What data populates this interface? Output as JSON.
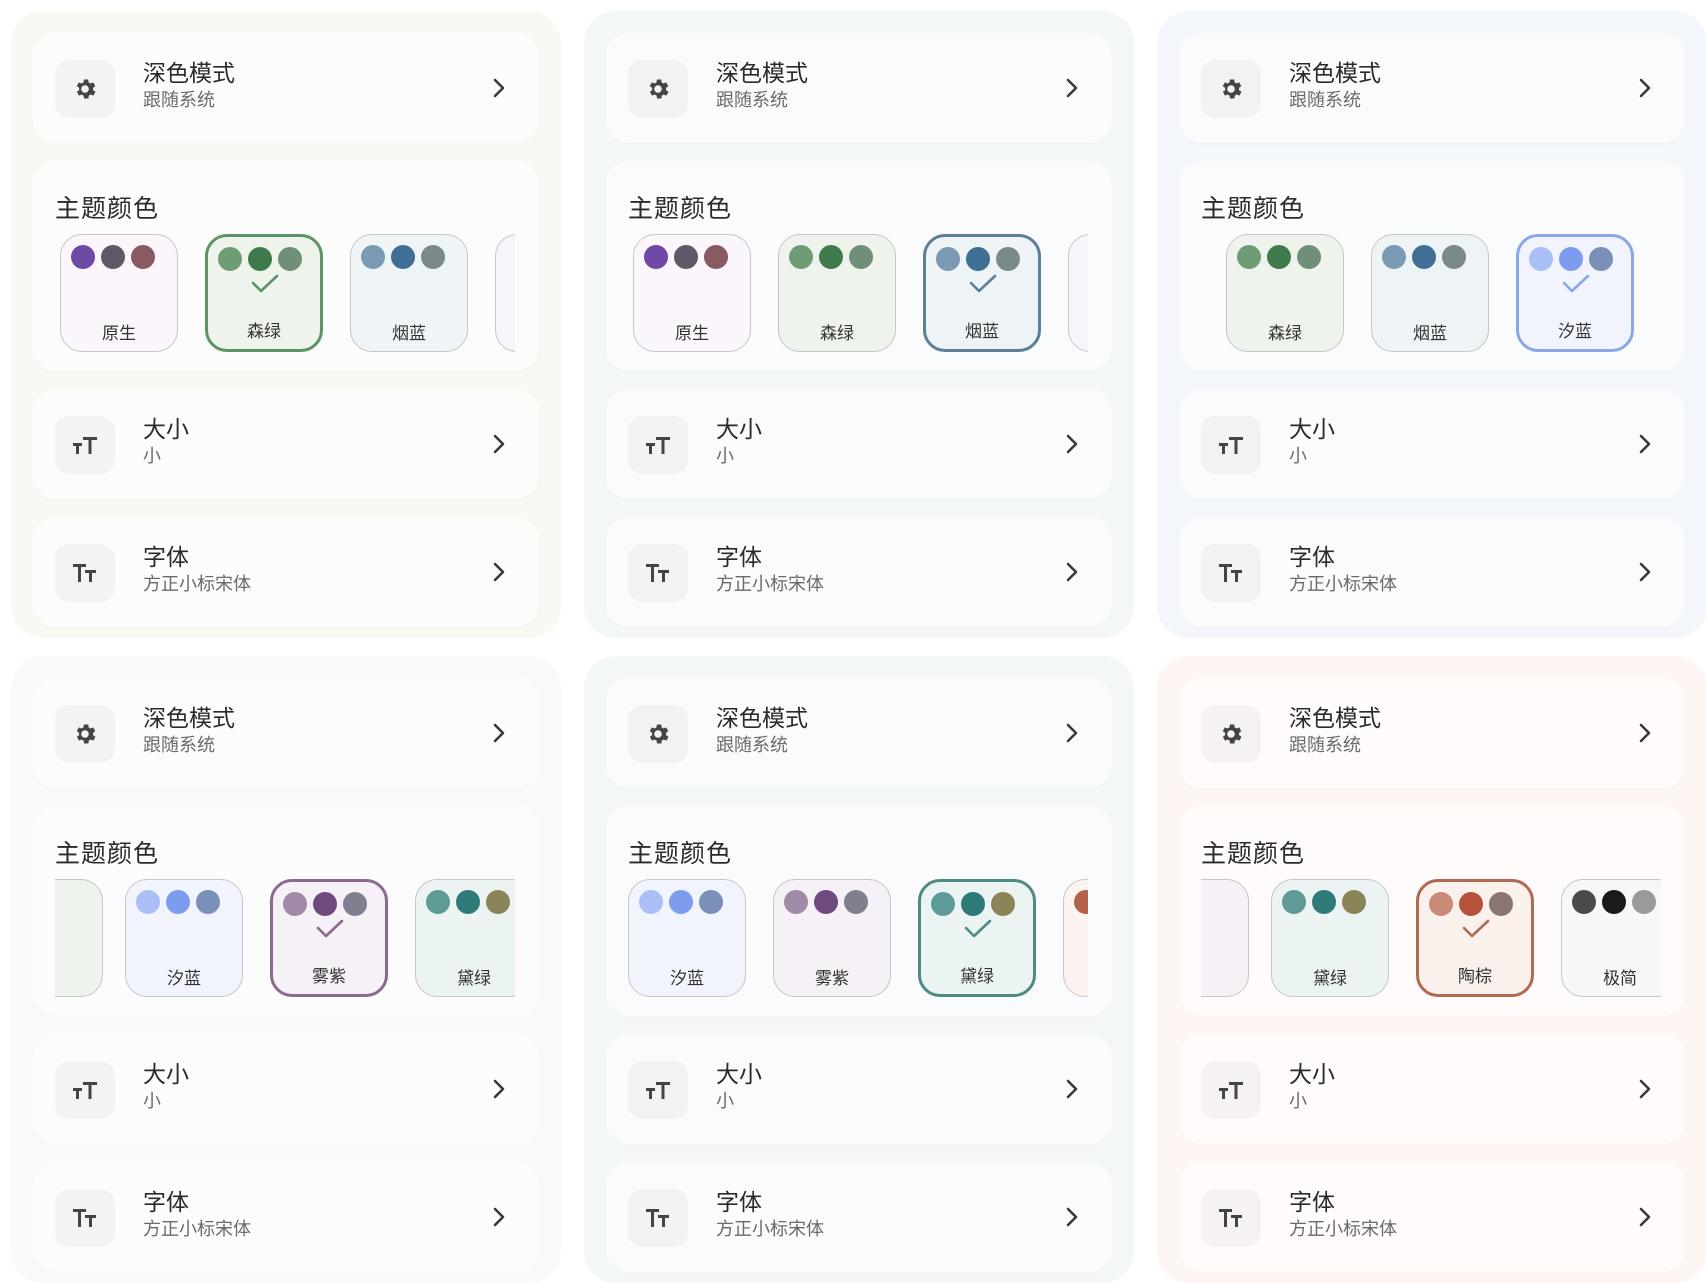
{
  "labels": {
    "dark_mode_title": "深色模式",
    "dark_mode_value": "跟随系统",
    "theme_color_title": "主题颜色",
    "size_title": "大小",
    "size_value": "小",
    "font_title": "字体",
    "font_value": "方正小标宋体"
  },
  "icons": {
    "dark_mode": "gear-icon",
    "size": "text-size-icon",
    "font": "font-icon",
    "chevron": "chevron-right-icon",
    "selected_mark": "check-icon"
  },
  "panels": [
    {
      "bg": "#f9f9f3",
      "swatches": [
        {
          "label": "原生",
          "dots": [
            "#6e4aa6",
            "#5e5868",
            "#8a5a62"
          ],
          "bg": "#fbf6fb",
          "border": "#c6c4c8",
          "selected": false
        },
        {
          "label": "森绿",
          "dots": [
            "#6f9b75",
            "#3f7a4c",
            "#6f8f78"
          ],
          "bg": "#eef4ec",
          "border": "#5b9467",
          "selected": true
        },
        {
          "label": "烟蓝",
          "dots": [
            "#7b9ab4",
            "#3f6f94",
            "#7a8a8a"
          ],
          "bg": "#eff4f7",
          "border": "#c4c7c9",
          "selected": false
        },
        {
          "label": "",
          "dots": [],
          "bg": "#f5f6fa",
          "border": "#c6c8cc",
          "selected": false
        }
      ]
    },
    {
      "bg": "#f3f7f8",
      "swatches": [
        {
          "label": "原生",
          "dots": [
            "#6e4aa6",
            "#5e5868",
            "#8a5a62"
          ],
          "bg": "#fbf6fb",
          "border": "#c6c4c8",
          "selected": false
        },
        {
          "label": "森绿",
          "dots": [
            "#6f9b75",
            "#3f7a4c",
            "#6f8f78"
          ],
          "bg": "#eef4ec",
          "border": "#c4c8c4",
          "selected": false
        },
        {
          "label": "烟蓝",
          "dots": [
            "#7b9ab4",
            "#3f6f94",
            "#7a8a8a"
          ],
          "bg": "#eef3f6",
          "border": "#5d7f98",
          "selected": true
        },
        {
          "label": "",
          "dots": [],
          "bg": "#f5f6fa",
          "border": "#c6c8cc",
          "selected": false
        }
      ]
    },
    {
      "bg": "#f3f6fb",
      "swatches": [
        {
          "label": "",
          "dots": [],
          "bg": "#f2f4f6",
          "border": "#c6c8cc",
          "selected": false
        },
        {
          "label": "森绿",
          "dots": [
            "#6f9b75",
            "#3f7a4c",
            "#6f8f78"
          ],
          "bg": "#eef4ec",
          "border": "#c4c8c4",
          "selected": false
        },
        {
          "label": "烟蓝",
          "dots": [
            "#7b9ab4",
            "#3f6f94",
            "#7a8a8a"
          ],
          "bg": "#eef3f6",
          "border": "#c4c7c9",
          "selected": false
        },
        {
          "label": "汐蓝",
          "dots": [
            "#a9bff5",
            "#7d9cf0",
            "#7a90b8"
          ],
          "bg": "#f1f4fc",
          "border": "#8aa7e8",
          "selected": true
        }
      ]
    },
    {
      "bg": "#fbf8fb",
      "swatches": [
        {
          "label": "",
          "dots": [
            "#6f8f78"
          ],
          "bg": "#eef4ec",
          "border": "#c4c8c4",
          "selected": false
        },
        {
          "label": "汐蓝",
          "dots": [
            "#a9bff5",
            "#7d9cf0",
            "#7a90b8"
          ],
          "bg": "#f1f4fc",
          "border": "#c4c7cc",
          "selected": false
        },
        {
          "label": "雾紫",
          "dots": [
            "#a08aa8",
            "#6e4a7e",
            "#7f7f8f"
          ],
          "bg": "#f6f1f7",
          "border": "#8a6a8e",
          "selected": true
        },
        {
          "label": "黛绿",
          "dots": [
            "#5e9a96",
            "#2e7a78",
            "#8a8458"
          ],
          "bg": "#ecf4f3",
          "border": "#c4c8c8",
          "selected": false
        }
      ]
    },
    {
      "bg": "#f3f7f8",
      "swatches": [
        {
          "label": "汐蓝",
          "dots": [
            "#a9bff5",
            "#7d9cf0",
            "#7a90b8"
          ],
          "bg": "#f1f4fc",
          "border": "#c4c7cc",
          "selected": false
        },
        {
          "label": "雾紫",
          "dots": [
            "#a08aa8",
            "#6e4a7e",
            "#7f7f8f"
          ],
          "bg": "#f6f1f7",
          "border": "#c8c4ca",
          "selected": false
        },
        {
          "label": "黛绿",
          "dots": [
            "#5e9a96",
            "#2e7a78",
            "#8a8458"
          ],
          "bg": "#ecf4f3",
          "border": "#4f8a86",
          "selected": true
        },
        {
          "label": "",
          "dots": [
            "#b4604a"
          ],
          "bg": "#fbf3ef",
          "border": "#cbc6c4",
          "selected": false
        }
      ]
    },
    {
      "bg": "#fdf6f3",
      "swatches": [
        {
          "label": "",
          "dots": [
            "#7f7f8f"
          ],
          "bg": "#f6f1f7",
          "border": "#c8c4ca",
          "selected": false
        },
        {
          "label": "黛绿",
          "dots": [
            "#5e9a96",
            "#2e7a78",
            "#8a8458"
          ],
          "bg": "#ecf4f3",
          "border": "#c4c8c8",
          "selected": false
        },
        {
          "label": "陶棕",
          "dots": [
            "#c98a78",
            "#b4533a",
            "#8a7474"
          ],
          "bg": "#fbf1ec",
          "border": "#b06a52",
          "selected": true
        },
        {
          "label": "极简",
          "dots": [
            "#4a4a4a",
            "#1a1a1a",
            "#9a9a9a"
          ],
          "bg": "#f7f7f7",
          "border": "#c6c6c6",
          "selected": false
        }
      ]
    }
  ]
}
